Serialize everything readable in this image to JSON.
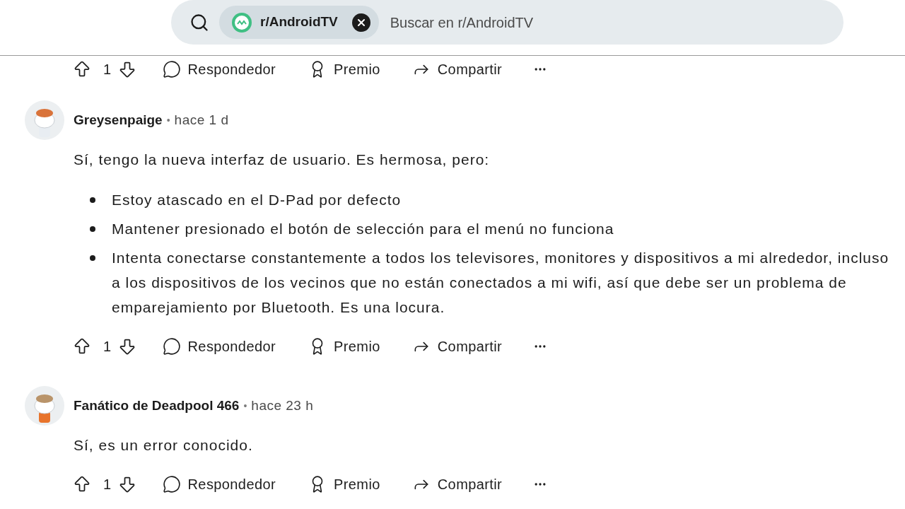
{
  "search": {
    "community": "r/AndroidTV",
    "placeholder": "Buscar en r/AndroidTV"
  },
  "partial_actions": {
    "count": "1",
    "reply": "Respondedor",
    "award": "Premio",
    "share": "Compartir"
  },
  "comments": [
    {
      "author": "Greysenpaige",
      "separator": "•",
      "time": "hace 1 d",
      "text": "Sí, tengo la nueva interfaz de usuario. Es hermosa, pero:",
      "bullets": [
        "Estoy atascado en el D-Pad por defecto",
        "Mantener presionado el botón de selección para el menú no funciona",
        "Intenta conectarse constantemente a todos los televisores, monitores y dispositivos a mi alrededor, incluso a los dispositivos de los vecinos que no están conectados a mi wifi, así que debe ser un problema de emparejamiento por Bluetooth. Es una locura."
      ],
      "actions": {
        "count": "1",
        "reply": "Respondedor",
        "award": "Premio",
        "share": "Compartir"
      }
    },
    {
      "author": "Fanático de Deadpool 466",
      "separator": "•",
      "time": "hace 23 h",
      "text": "Sí, es un error conocido.",
      "actions": {
        "count": "1",
        "reply": "Respondedor",
        "award": "Premio",
        "share": "Compartir"
      }
    }
  ]
}
